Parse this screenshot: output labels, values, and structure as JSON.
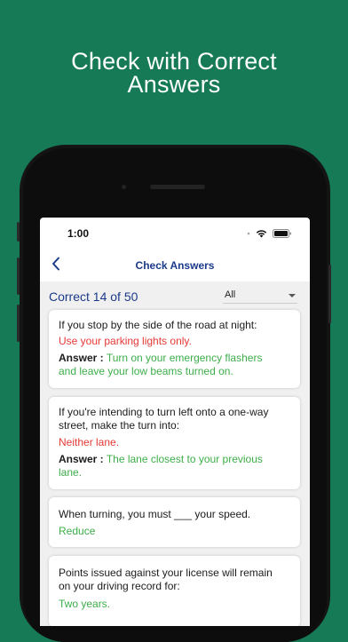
{
  "headline": {
    "line1": "Check with Correct",
    "line2": "Answers"
  },
  "statusbar": {
    "time": "1:00"
  },
  "nav": {
    "title": "Check Answers"
  },
  "summary": {
    "correct_text": "Correct 14 of 50",
    "filter_value": "All"
  },
  "answer_prefix": "Answer :",
  "cards": [
    {
      "question": "If you stop by the side of the road at night:",
      "your_answer": "Use your parking lights only.",
      "correct_line1": "Turn on your emergency flashers",
      "correct_line2": "and leave your low beams turned on."
    },
    {
      "question_line1": "If you're intending to turn left onto a one-way",
      "question_line2": "street, make the turn into:",
      "your_answer": "Neither lane.",
      "correct_line1": "The lane closest to your previous",
      "correct_line2": "lane."
    },
    {
      "question": "When turning, you must ___ your speed.",
      "your_answer": "Reduce"
    },
    {
      "question_line1": "Points issued against your license will remain",
      "question_line2": "on your driving record for:",
      "your_answer": "Two years."
    }
  ],
  "colors": {
    "background": "#167a57",
    "wrong": "#e53935",
    "correct": "#3dae4a",
    "nav_blue": "#1a3a8a"
  }
}
